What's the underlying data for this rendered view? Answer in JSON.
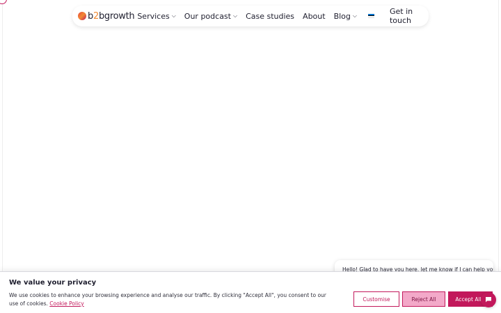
{
  "nav": {
    "logo": {
      "part1": "b",
      "part2": "2",
      "part3": "bgrowth"
    },
    "items": [
      {
        "label": "Services",
        "dropdown": true
      },
      {
        "label": "Our podcast",
        "dropdown": true
      },
      {
        "label": "Case studies",
        "dropdown": false
      },
      {
        "label": "About",
        "dropdown": false
      },
      {
        "label": "Blog",
        "dropdown": true
      }
    ],
    "language_flag": "estonia-flag",
    "cta_label": "Get in touch"
  },
  "chat": {
    "message": "Hello! Glad to have you here, let me know if I can help you",
    "launcher_icon": "chat-icon"
  },
  "cookie_banner": {
    "title": "We value your privacy",
    "text": "We use cookies to enhance your browsing experience and analyse our traffic. By clicking \"Accept All\", you consent to our use of cookies.",
    "link_label": "Cookie Policy",
    "buttons": {
      "customise": "Customise",
      "reject": "Reject All",
      "accept": "Accept All"
    }
  },
  "colors": {
    "accent": "#c2185b",
    "accent_light": "#f3a9c9",
    "logo_orange": "#f28b34"
  }
}
